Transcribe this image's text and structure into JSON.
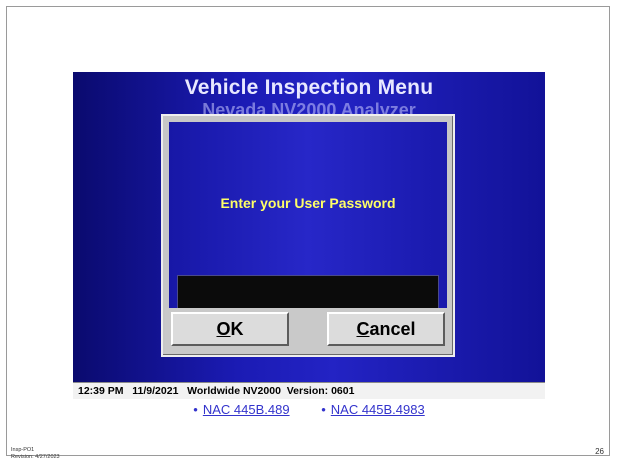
{
  "screen": {
    "title": "Vehicle Inspection Menu",
    "subtitle_partial": "Nevada NV2000 Analyzer"
  },
  "dialog": {
    "prompt": "Enter your User Password",
    "password_value": "",
    "ok_mnemonic": "O",
    "ok_rest": "K",
    "cancel_mnemonic": "C",
    "cancel_rest": "ancel"
  },
  "statusbar": {
    "text": "12:39 PM   11/9/2021   Worldwide NV2000  Version: 0601"
  },
  "links": [
    {
      "bullet": "•",
      "label": "NAC 445B.489"
    },
    {
      "bullet": "•",
      "label": "NAC 445B.4983"
    }
  ],
  "footer": {
    "doc_id": "Insp-PO1",
    "revision": "Revision: 4/27/2023",
    "page_number": "26"
  },
  "colors": {
    "screen_blue": "#1b1bb4",
    "prompt_yellow": "#ffff66",
    "link_blue": "#3333cc"
  }
}
